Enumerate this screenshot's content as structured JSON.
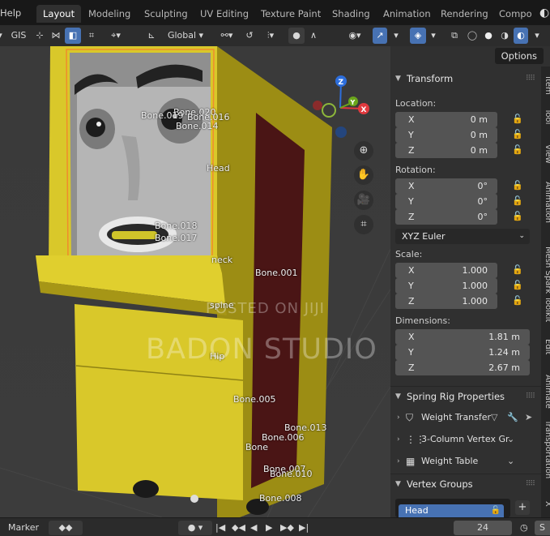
{
  "topbar": {
    "help": "Help",
    "workspaces": [
      "Layout",
      "Modeling",
      "Sculpting",
      "UV Editing",
      "Texture Paint",
      "Shading",
      "Animation",
      "Rendering",
      "Compo"
    ],
    "active_workspace": "Layout"
  },
  "toolbar": {
    "gis": "GIS",
    "orientation": "Global",
    "options": "Options"
  },
  "viewport": {
    "bones": [
      {
        "label": "Bone.020"
      },
      {
        "label": "Bone.019"
      },
      {
        "label": "Bone.016"
      },
      {
        "label": "Bone.014"
      },
      {
        "label": "Head"
      },
      {
        "label": "Bone.018"
      },
      {
        "label": "Bone.017"
      },
      {
        "label": "neck"
      },
      {
        "label": "Bone.001"
      },
      {
        "label": "spine"
      },
      {
        "label": "Hip"
      },
      {
        "label": "Bone.005"
      },
      {
        "label": "Bone.013"
      },
      {
        "label": "Bone.006"
      },
      {
        "label": "Bone"
      },
      {
        "label": "Bone.007"
      },
      {
        "label": "Bone.010"
      },
      {
        "label": "Bone.008"
      }
    ],
    "watermark_small": "POSTED ON JIJI",
    "watermark_large": "BADON STUDIO",
    "gizmo": {
      "x": "X",
      "y": "Y",
      "z": "Z"
    }
  },
  "npanel": {
    "transform": {
      "title": "Transform",
      "location_label": "Location:",
      "location": [
        {
          "axis": "X",
          "value": "0 m"
        },
        {
          "axis": "Y",
          "value": "0 m"
        },
        {
          "axis": "Z",
          "value": "0 m"
        }
      ],
      "rotation_label": "Rotation:",
      "rotation": [
        {
          "axis": "X",
          "value": "0°"
        },
        {
          "axis": "Y",
          "value": "0°"
        },
        {
          "axis": "Z",
          "value": "0°"
        }
      ],
      "rotation_mode": "XYZ Euler",
      "scale_label": "Scale:",
      "scale": [
        {
          "axis": "X",
          "value": "1.000"
        },
        {
          "axis": "Y",
          "value": "1.000"
        },
        {
          "axis": "Z",
          "value": "1.000"
        }
      ],
      "dimensions_label": "Dimensions:",
      "dimensions": [
        {
          "axis": "X",
          "value": "1.81 m"
        },
        {
          "axis": "Y",
          "value": "1.24 m"
        },
        {
          "axis": "Z",
          "value": "2.67 m"
        }
      ]
    },
    "spring_rig": {
      "title": "Spring Rig Properties",
      "items": [
        "Weight Transfer",
        "3-Column Vertex Gr",
        "Weight Table"
      ]
    },
    "vertex_groups": {
      "title": "Vertex Groups",
      "items": [
        "Head"
      ]
    },
    "side_tabs": [
      "Item",
      "Tool",
      "View",
      "Animation",
      "Mesh Spark Toolkit",
      "Edit",
      "Animate",
      "Transportation",
      "X"
    ]
  },
  "timeline": {
    "marker": "Marker",
    "current_frame": "24",
    "start_frame": "S"
  },
  "colors": {
    "accent": "#4772b3",
    "selection_orange": "#f08c2c",
    "booth_yellow": "#d6c528"
  }
}
